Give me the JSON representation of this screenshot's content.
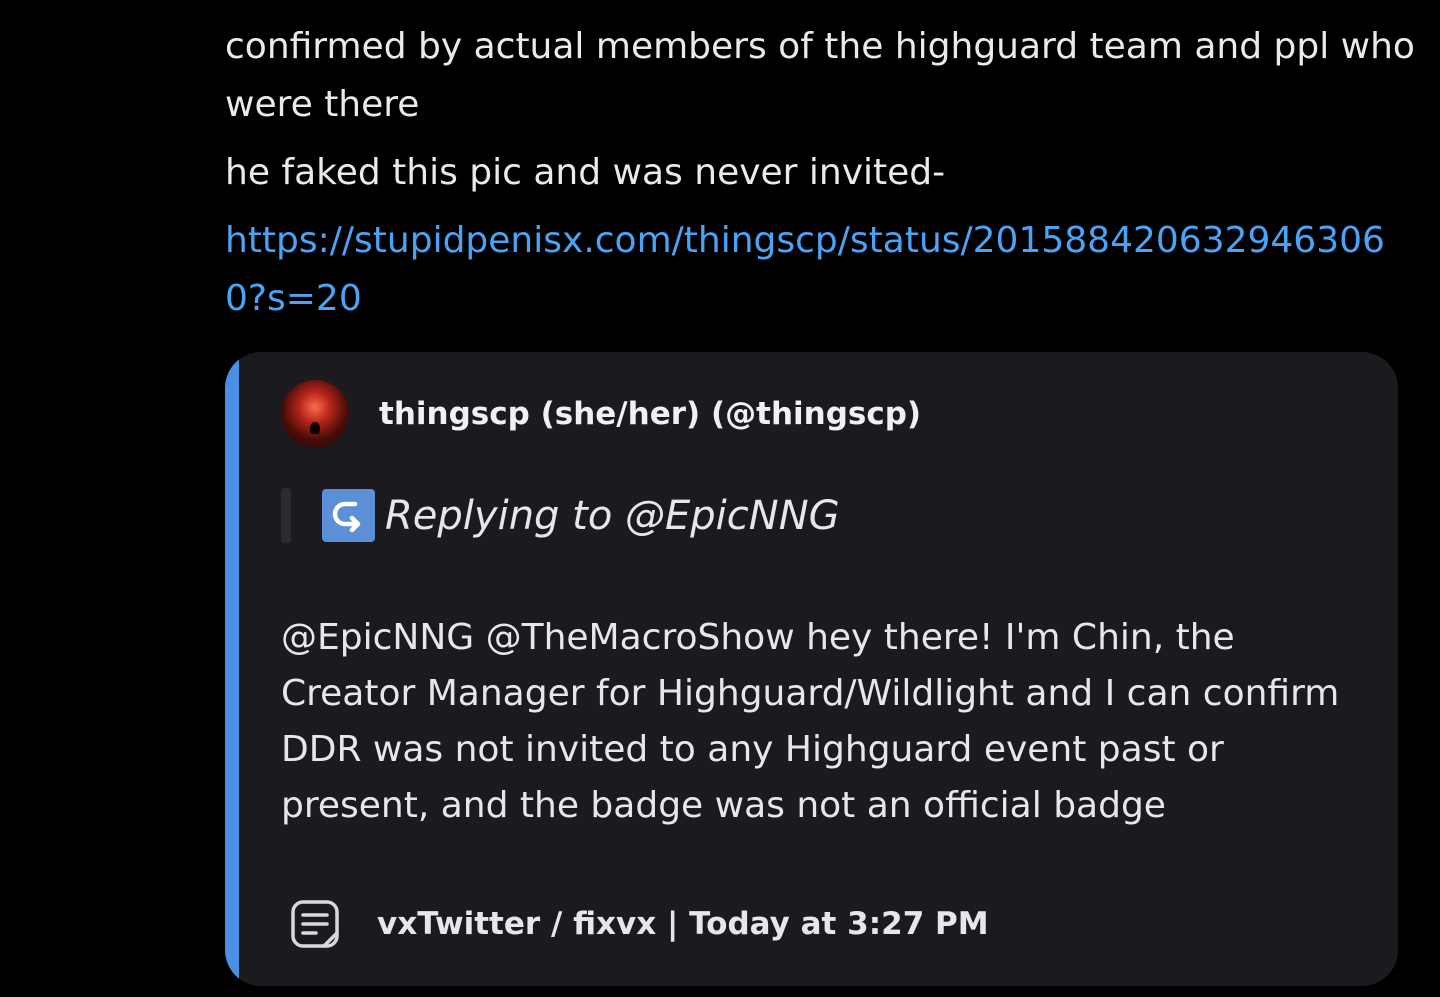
{
  "message": {
    "line1": "confirmed by actual members of the highguard team and ppl who were there",
    "line2": "he faked this pic and was never invited-",
    "link": "https://stupidpenisx.com/thingscp/status/2015884206329463060?s=20"
  },
  "embed": {
    "accent_color": "#4a90e2",
    "author": "thingscp (she/her) (@thingscp)",
    "reply_label": "Replying to @EpicNNG",
    "body": "@EpicNNG @TheMacroShow hey there! I'm Chin, the Creator Manager for Highguard/Wildlight and I can confirm DDR was not invited to any Highguard event past or present, and the badge was not an official badge",
    "footer": "vxTwitter / fixvx | Today at 3:27 PM",
    "icons": {
      "avatar": "profile-avatar",
      "reply": "reply-arrow-icon",
      "footer": "notepad-icon"
    }
  }
}
